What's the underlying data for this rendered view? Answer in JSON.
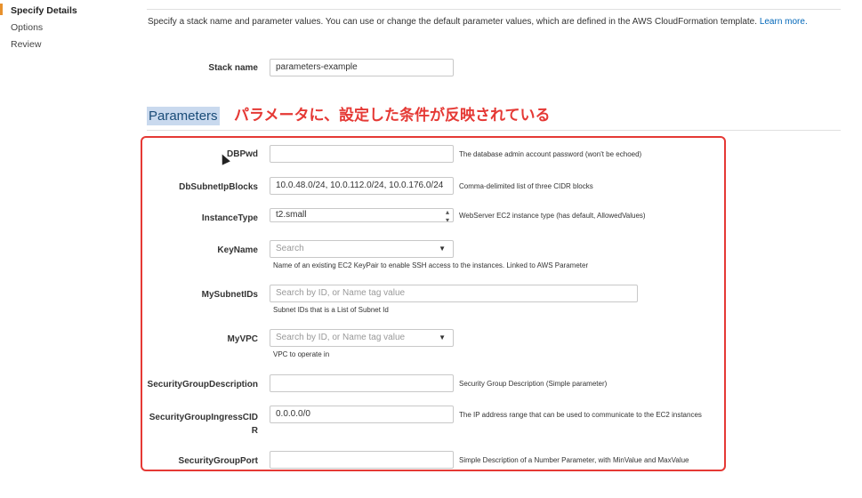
{
  "sidebar": {
    "items": [
      {
        "label": "Specify Details",
        "active": true
      },
      {
        "label": "Options",
        "active": false
      },
      {
        "label": "Review",
        "active": false
      }
    ]
  },
  "intro": {
    "text": "Specify a stack name and parameter values. You can use or change the default parameter values, which are defined in the AWS CloudFormation template.",
    "link": "Learn more."
  },
  "stack": {
    "label": "Stack name",
    "value": "parameters-example"
  },
  "parameters": {
    "title": "Parameters",
    "annotation": "パラメータに、設定した条件が反映されている"
  },
  "fields": {
    "dbpwd": {
      "label": "DBPwd",
      "value": "",
      "hint": "The database admin account password (won't be echoed)"
    },
    "dbsubnet": {
      "label": "DbSubnetIpBlocks",
      "value": "10.0.48.0/24, 10.0.112.0/24, 10.0.176.0/24",
      "hint": "Comma-delimited list of three CIDR blocks"
    },
    "instancetype": {
      "label": "InstanceType",
      "value": "t2.small",
      "hint": "WebServer EC2 instance type (has default, AllowedValues)"
    },
    "keyname": {
      "label": "KeyName",
      "placeholder": "Search",
      "sub": "Name of an existing EC2 KeyPair to enable SSH access to the instances. Linked to AWS Parameter"
    },
    "mysubnetids": {
      "label": "MySubnetIDs",
      "placeholder": "Search by ID, or Name tag value",
      "sub": "Subnet IDs that is a List of Subnet Id"
    },
    "myvpc": {
      "label": "MyVPC",
      "placeholder": "Search by ID, or Name tag value",
      "sub": "VPC to operate in"
    },
    "sgdesc": {
      "label": "SecurityGroupDescription",
      "value": "",
      "hint": "Security Group Description (Simple parameter)"
    },
    "sgingress": {
      "label_line1": "SecurityGroupIngressCID",
      "label_line2": "R",
      "value": "0.0.0.0/0",
      "hint": "The IP address range that can be used to communicate to the EC2 instances"
    },
    "sgport": {
      "label": "SecurityGroupPort",
      "value": "",
      "hint": "Simple Description of a Number Parameter, with MinValue and MaxValue"
    }
  },
  "colors": {
    "accent": "#e8912d",
    "annotation": "#e53935",
    "link": "#0066b8",
    "title": "#1a4c78"
  }
}
